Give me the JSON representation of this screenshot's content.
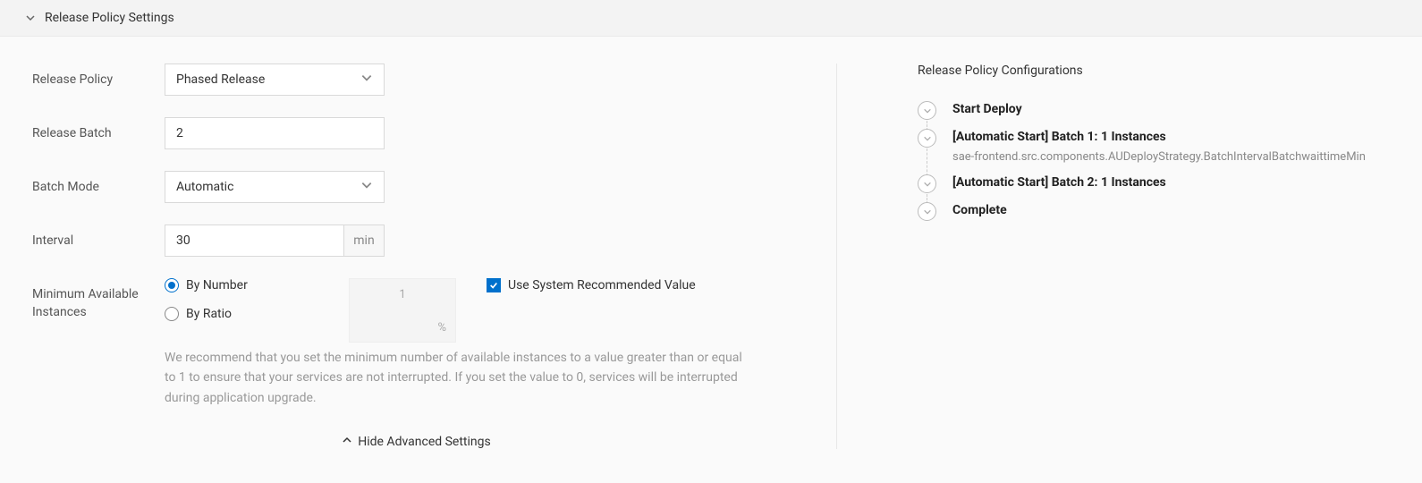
{
  "section": {
    "title": "Release Policy Settings"
  },
  "form": {
    "release_policy_label": "Release Policy",
    "release_policy_value": "Phased Release",
    "release_batch_label": "Release Batch",
    "release_batch_value": "2",
    "batch_mode_label": "Batch Mode",
    "batch_mode_value": "Automatic",
    "interval_label": "Interval",
    "interval_value": "30",
    "interval_unit": "min",
    "min_avail_label": "Minimum Available Instances",
    "radio_by_number": "By Number",
    "radio_by_ratio": "By Ratio",
    "disabled_value_top": "1",
    "disabled_value_bottom": "%",
    "use_recommended_label": "Use System Recommended Value",
    "help_text": "We recommend that you set the minimum number of available instances to a value greater than or equal to 1 to ensure that your services are not interrupted. If you set the value to 0, services will be interrupted during application upgrade.",
    "hide_advanced_label": "Hide Advanced Settings"
  },
  "right": {
    "title": "Release Policy Configurations",
    "steps": {
      "s0": {
        "label": "Start Deploy"
      },
      "s1": {
        "label": "[Automatic Start] Batch 1: 1 Instances",
        "sub": "sae-frontend.src.components.AUDeployStrategy.BatchIntervalBatchwaittimeMin"
      },
      "s2": {
        "label": "[Automatic Start] Batch 2: 1 Instances"
      },
      "s3": {
        "label": "Complete"
      }
    }
  }
}
